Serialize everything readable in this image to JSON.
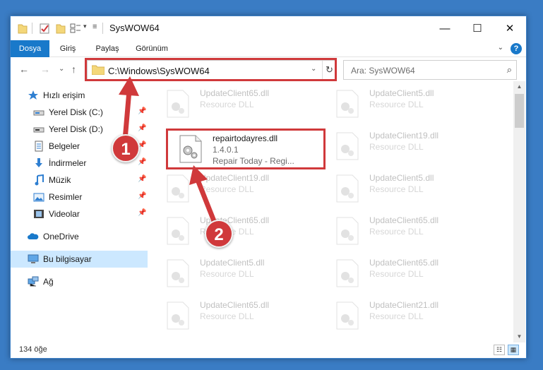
{
  "window": {
    "title": "SysWOW64",
    "minimize": "—",
    "maximize": "☐",
    "close": "✕"
  },
  "ribbon": {
    "tabs": [
      "Dosya",
      "Giriş",
      "Paylaş",
      "Görünüm"
    ],
    "help": "?"
  },
  "nav": {
    "back": "←",
    "forward": "→",
    "dropdown": "⌄",
    "up": "↑"
  },
  "address": {
    "path": "C:\\Windows\\SysWOW64",
    "refresh": "↻",
    "dropdown": "⌄"
  },
  "search": {
    "placeholder": "Ara: SysWOW64",
    "icon": "⌕"
  },
  "sidebar": {
    "items": [
      {
        "label": "Hızlı erişim",
        "icon": "star-icon"
      },
      {
        "label": "Yerel Disk (C:)",
        "icon": "drive-icon",
        "pinned": true
      },
      {
        "label": "Yerel Disk (D:)",
        "icon": "drive-icon",
        "pinned": true
      },
      {
        "label": "Belgeler",
        "icon": "documents-icon",
        "pinned": true
      },
      {
        "label": "İndirmeler",
        "icon": "download-icon",
        "pinned": true
      },
      {
        "label": "Müzik",
        "icon": "music-icon",
        "pinned": true
      },
      {
        "label": "Resimler",
        "icon": "pictures-icon",
        "pinned": true
      },
      {
        "label": "Videolar",
        "icon": "videos-icon",
        "pinned": true
      },
      {
        "label": "OneDrive",
        "icon": "cloud-icon"
      },
      {
        "label": "Bu bilgisayar",
        "icon": "computer-icon",
        "selected": true
      },
      {
        "label": "Ağ",
        "icon": "network-icon"
      }
    ],
    "pin_glyph": "📌"
  },
  "files": {
    "highlighted": {
      "name": "repairtodayres.dll",
      "version": "1.4.0.1",
      "description": "Repair Today - Regi..."
    },
    "left_column": [
      {
        "name": "UpdateClient65.dll",
        "type": "Resource DLL"
      },
      {
        "name": "UpdateClient19.dll",
        "type": "Resource DLL"
      },
      {
        "name": "UpdateClient65.dll",
        "type": "Resource DLL"
      },
      {
        "name": "UpdateClient5.dll",
        "type": "Resource DLL"
      },
      {
        "name": "UpdateClient65.dll",
        "type": "Resource DLL"
      }
    ],
    "right_column": [
      {
        "name": "UpdateClient5.dll",
        "type": "Resource DLL"
      },
      {
        "name": "UpdateClient19.dll",
        "type": "Resource DLL"
      },
      {
        "name": "UpdateClient5.dll",
        "type": "Resource DLL"
      },
      {
        "name": "UpdateClient65.dll",
        "type": "Resource DLL"
      },
      {
        "name": "UpdateClient65.dll",
        "type": "Resource DLL"
      },
      {
        "name": "UpdateClient21.dll",
        "type": "Resource DLL"
      }
    ]
  },
  "status": {
    "count": "134 öğe",
    "view_details": "☷",
    "view_tiles": "▦"
  },
  "callouts": {
    "one": "1",
    "two": "2"
  },
  "colors": {
    "accent": "#1979ca",
    "highlight": "#d0393b",
    "selected": "#cce8ff"
  }
}
